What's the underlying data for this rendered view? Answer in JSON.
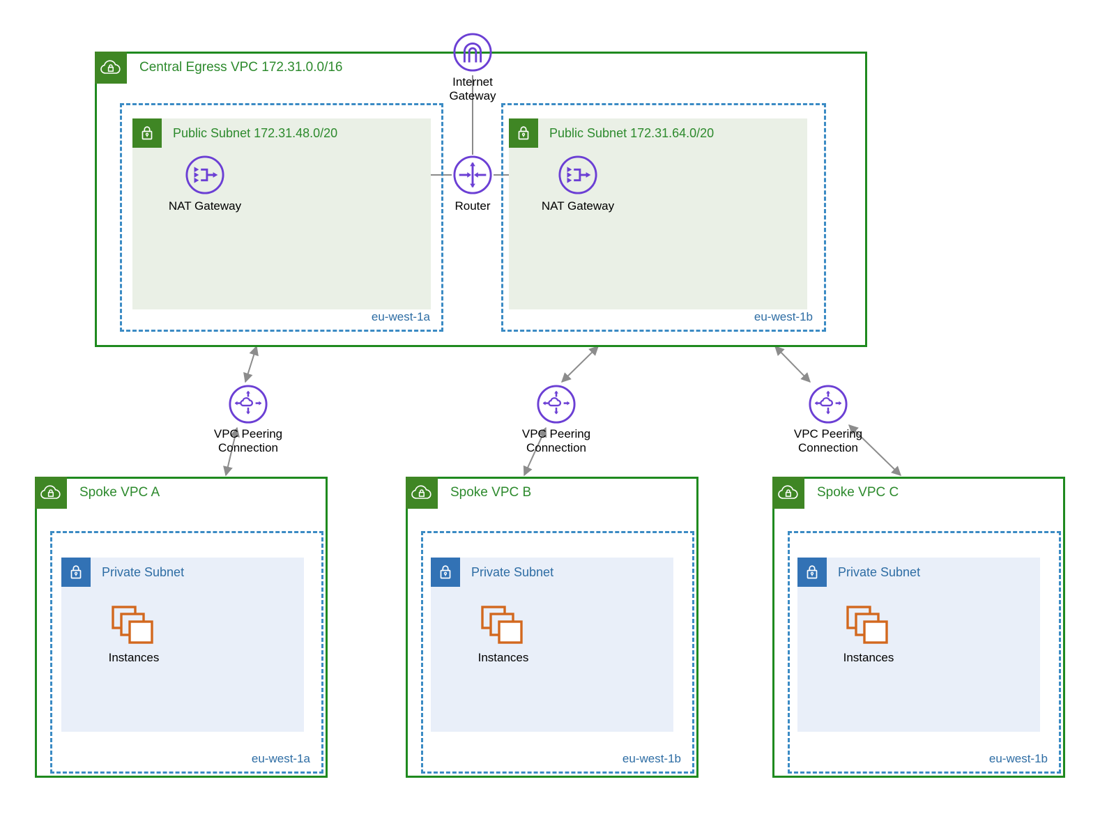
{
  "diagram": {
    "title": "AWS Central Egress VPC with Spoke VPC Peering",
    "colors": {
      "vpc_green": "#1f8a1f",
      "vpc_tile_green": "#3f8624",
      "vpc_title_green": "#2d8a2d",
      "az_blue": "#3b8bc4",
      "az_label_blue": "#2e6da4",
      "subnet_public_fill": "#eaf0e6",
      "subnet_private_fill": "#e9eff9",
      "private_tile_blue": "#3272b5",
      "resource_purple": "#6b3fd4",
      "instance_orange": "#d2681e",
      "connector_gray": "#808080",
      "arrow_gray": "#8c8c8c"
    }
  },
  "central_vpc": {
    "icon": "vpc-cloud-lock-icon",
    "title": "Central Egress VPC 172.31.0.0/16",
    "availability_zones": [
      {
        "label": "eu-west-1a",
        "subnet": {
          "icon": "subnet-lock-icon",
          "title": "Public Subnet 172.31.48.0/20",
          "type": "public"
        },
        "resources": [
          {
            "icon": "nat-gateway-icon",
            "label": "NAT Gateway"
          }
        ]
      },
      {
        "label": "eu-west-1b",
        "subnet": {
          "icon": "subnet-lock-icon",
          "title": "Public Subnet 172.31.64.0/20",
          "type": "public"
        },
        "resources": [
          {
            "icon": "nat-gateway-icon",
            "label": "NAT Gateway"
          }
        ]
      }
    ],
    "router": {
      "icon": "router-icon",
      "label": "Router"
    }
  },
  "internet_gateway": {
    "icon": "internet-gateway-icon",
    "label": "Internet\nGateway"
  },
  "peering_connections": [
    {
      "icon": "vpc-peering-icon",
      "label": "VPC Peering\nConnection"
    },
    {
      "icon": "vpc-peering-icon",
      "label": "VPC Peering\nConnection"
    },
    {
      "icon": "vpc-peering-icon",
      "label": "VPC Peering\nConnection"
    }
  ],
  "spoke_vpcs": [
    {
      "icon": "vpc-cloud-lock-icon",
      "title": "Spoke VPC A",
      "az_label": "eu-west-1a",
      "subnet": {
        "icon": "subnet-lock-icon",
        "title": "Private Subnet",
        "type": "private"
      },
      "resource": {
        "icon": "instances-icon",
        "label": "Instances"
      }
    },
    {
      "icon": "vpc-cloud-lock-icon",
      "title": "Spoke VPC B",
      "az_label": "eu-west-1b",
      "subnet": {
        "icon": "subnet-lock-icon",
        "title": "Private Subnet",
        "type": "private"
      },
      "resource": {
        "icon": "instances-icon",
        "label": "Instances"
      }
    },
    {
      "icon": "vpc-cloud-lock-icon",
      "title": "Spoke VPC C",
      "az_label": "eu-west-1b",
      "subnet": {
        "icon": "subnet-lock-icon",
        "title": "Private Subnet",
        "type": "private"
      },
      "resource": {
        "icon": "instances-icon",
        "label": "Instances"
      }
    }
  ]
}
